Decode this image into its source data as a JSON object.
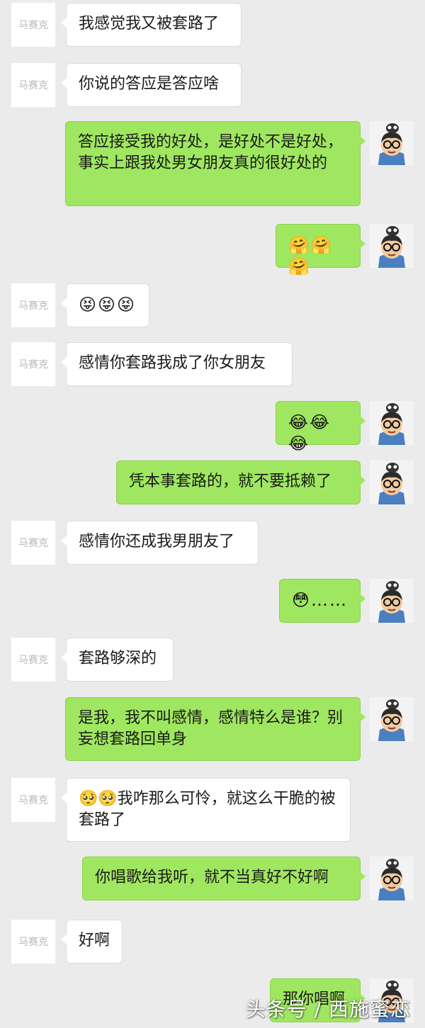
{
  "contact_name": "马赛克",
  "messages": [
    {
      "side": "left",
      "text": "我感觉我又被套路了"
    },
    {
      "side": "left",
      "text": "你说的答应是答应啥"
    },
    {
      "side": "right",
      "text": "答应接受我的好处，是好处不是好处，事实上跟我处男女朋友真的很好处的"
    },
    {
      "side": "right",
      "text": "🤗🤗🤗"
    },
    {
      "side": "left",
      "text": "😝😝😝"
    },
    {
      "side": "left",
      "text": "感情你套路我成了你女朋友"
    },
    {
      "side": "right",
      "text": "😂😂😂"
    },
    {
      "side": "right",
      "text": "凭本事套路的，就不要抵赖了"
    },
    {
      "side": "left",
      "text": "感情你还成我男朋友了"
    },
    {
      "side": "right",
      "text": "😳……"
    },
    {
      "side": "left",
      "text": "套路够深的"
    },
    {
      "side": "right",
      "text": "是我，我不叫感情，感情特么是谁？别妄想套路回单身"
    },
    {
      "side": "left",
      "text": "🥺🥺我咋那么可怜，就这么干脆的被套路了"
    },
    {
      "side": "right",
      "text": "你唱歌给我听，就不当真好不好啊"
    },
    {
      "side": "left",
      "text": "好啊"
    },
    {
      "side": "right",
      "text": "那你唱啊"
    }
  ],
  "watermark": "头条号 / 西施蜜恋",
  "colors": {
    "background": "#ebebeb",
    "bubble_self": "#9fe760",
    "bubble_other": "#ffffff",
    "avatar_text": "#b9b9b9"
  }
}
